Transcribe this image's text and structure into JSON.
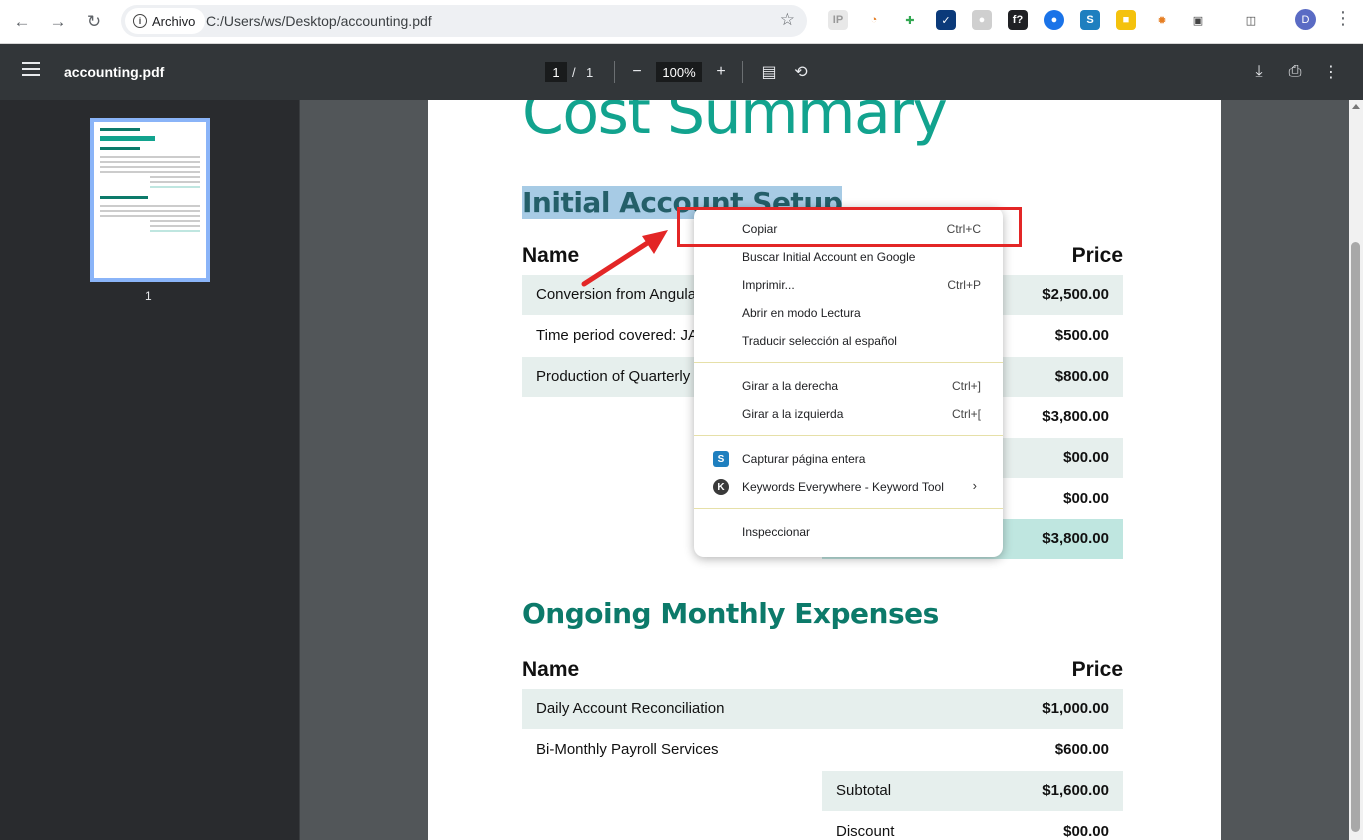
{
  "browser": {
    "chip_label": "Archivo",
    "url": "C:/Users/ws/Desktop/accounting.pdf",
    "avatar_letter": "D"
  },
  "toolbar": {
    "title": "accounting.pdf",
    "page_current": "1",
    "page_sep": "/",
    "page_total": "1",
    "zoom": "100%"
  },
  "sidebar": {
    "thumb_number": "1"
  },
  "document": {
    "title": "Cost Summary",
    "section1": {
      "heading": "Initial Account Setup",
      "col_name": "Name",
      "col_price": "Price",
      "rows": [
        {
          "name": "Conversion from Angula",
          "price": "$2,500.00"
        },
        {
          "name": "Time period covered: JA",
          "price": "$500.00"
        },
        {
          "name": "Production of Quarterly",
          "price": "$800.00"
        }
      ],
      "summary": [
        {
          "label": "",
          "price": "$3,800.00"
        },
        {
          "label": "",
          "price": "$00.00"
        },
        {
          "label": "",
          "price": "$00.00"
        },
        {
          "label": "",
          "price": "$3,800.00"
        }
      ]
    },
    "section2": {
      "heading": "Ongoing Monthly Expenses",
      "col_name": "Name",
      "col_price": "Price",
      "rows": [
        {
          "name": "Daily Account Reconciliation",
          "price": "$1,000.00"
        },
        {
          "name": "Bi-Monthly Payroll Services",
          "price": "$600.00"
        }
      ],
      "summary": [
        {
          "label": "Subtotal",
          "price": "$1,600.00"
        },
        {
          "label": "Discount",
          "price": "$00.00"
        }
      ]
    }
  },
  "context_menu": {
    "items": [
      {
        "label": "Copiar",
        "shortcut": "Ctrl+C"
      },
      {
        "label": "Buscar Initial Account en Google",
        "shortcut": ""
      },
      {
        "label": "Imprimir...",
        "shortcut": "Ctrl+P"
      },
      {
        "label": "Abrir en modo Lectura",
        "shortcut": ""
      },
      {
        "label": "Traducir selección al español",
        "shortcut": ""
      },
      {
        "label": "Girar a la derecha",
        "shortcut": "Ctrl+]"
      },
      {
        "label": "Girar a la izquierda",
        "shortcut": "Ctrl+["
      },
      {
        "label": "Capturar página entera",
        "shortcut": ""
      },
      {
        "label": "Keywords Everywhere - Keyword Tool",
        "shortcut": ""
      },
      {
        "label": "Inspeccionar",
        "shortcut": ""
      }
    ]
  },
  "colors": {
    "accent": "#12a38e",
    "heading": "#0c7a6a",
    "highlight": "#e32626"
  }
}
